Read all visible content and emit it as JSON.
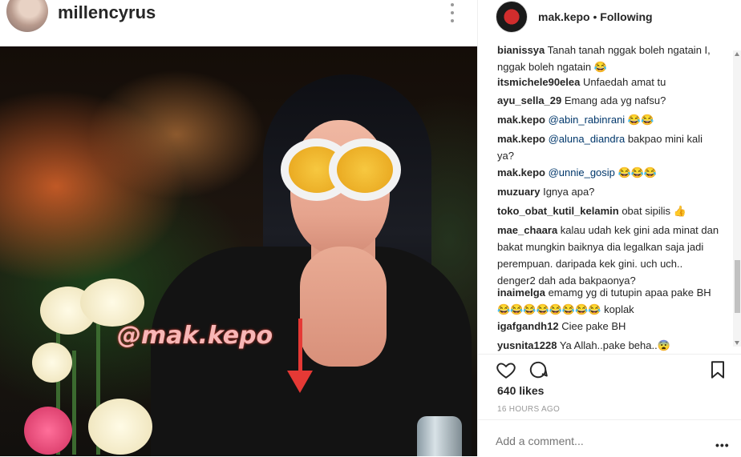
{
  "post": {
    "left_username": "millencyrus",
    "watermark": "@mak.kepo",
    "right_username": "mak.kepo",
    "separator": "•",
    "following": "Following",
    "likes": "640 likes",
    "timestamp": "16 HOURS AGO",
    "add_comment_placeholder": "Add a comment...",
    "more": "•••"
  },
  "comments": [
    {
      "user": "bianissya",
      "mention": "",
      "text": " Tanah tanah nggak boleh ngatain I, nggak boleh ngatain 😂"
    },
    {
      "user": "itsmichele90elea",
      "mention": "",
      "text": " Unfaedah amat tu"
    },
    {
      "user": "ayu_sella_29",
      "mention": "",
      "text": " Emang ada yg nafsu?"
    },
    {
      "user": "mak.kepo",
      "mention": " @abin_rabinrani",
      "text": " 😂😂"
    },
    {
      "user": "mak.kepo",
      "mention": " @aluna_diandra",
      "text": " bakpao mini kali ya?"
    },
    {
      "user": "mak.kepo",
      "mention": " @unnie_gosip",
      "text": " 😂😂😂"
    },
    {
      "user": "muzuary",
      "mention": "",
      "text": " Ignya apa?"
    },
    {
      "user": "toko_obat_kutil_kelamin",
      "mention": "",
      "text": " obat sipilis 👍"
    },
    {
      "user": "mae_chaara",
      "mention": "",
      "text": " kalau udah kek gini ada minat dan bakat mungkin baiknya dia legalkan saja jadi perempuan. daripada kek gini. uch uch.. denger2 dah ada bakpaonya?"
    },
    {
      "user": "inaimelga",
      "mention": "",
      "text": " emamg yg di tutupin apaa pake BH 😂😂😂😂😂😂😂😂 koplak"
    },
    {
      "user": "igafgandh12",
      "mention": "",
      "text": " Ciee pake BH"
    },
    {
      "user": "yusnita1228",
      "mention": "",
      "text": " Ya Allah..pake beha..😨"
    }
  ]
}
